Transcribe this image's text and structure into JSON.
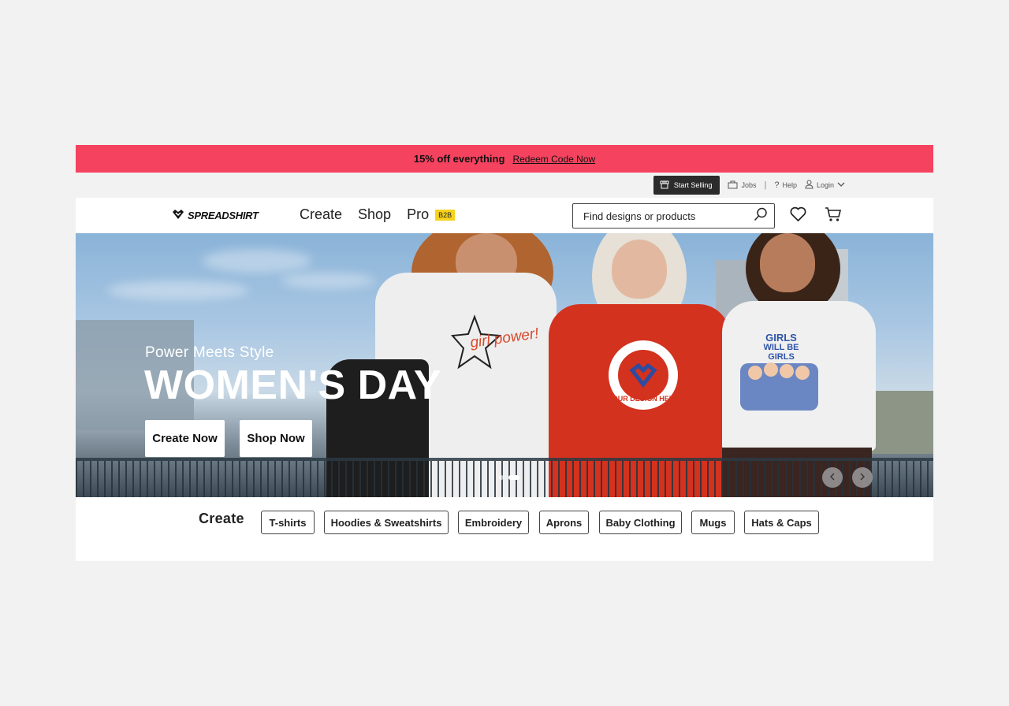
{
  "promo": {
    "text": "15% off everything",
    "link": "Redeem Code Now",
    "bg": "#f5425f"
  },
  "utility": {
    "start_selling": "Start Selling",
    "jobs": "Jobs",
    "separator": "|",
    "help": "Help",
    "login": "Login"
  },
  "header": {
    "logo": "SPREADSHIRT",
    "nav": [
      "Create",
      "Shop",
      "Pro"
    ],
    "pro_badge": "B2B",
    "search_placeholder": "Find designs or products"
  },
  "hero": {
    "subtitle": "Power Meets Style",
    "title": "WOMEN'S DAY",
    "buttons": [
      "Create Now",
      "Shop Now"
    ],
    "shirt_text": {
      "left": "girl power!",
      "middle": "YOUR DESIGN HERE",
      "right_line1": "GIRLS",
      "right_line2": "WILL BE GIRLS"
    },
    "slides": 2,
    "active_slide": 2
  },
  "categories": {
    "title": "Create",
    "items": [
      "T-shirts",
      "Hoodies & Sweatshirts",
      "Embroidery",
      "Aprons",
      "Baby Clothing",
      "Mugs",
      "Hats & Caps"
    ]
  }
}
